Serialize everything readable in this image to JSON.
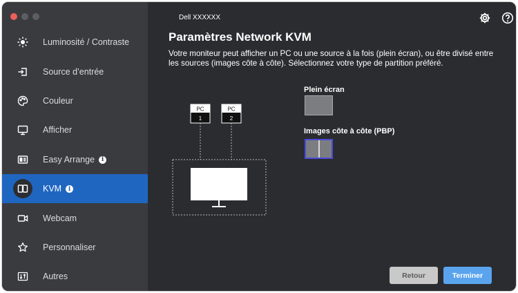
{
  "window": {
    "monitor_name": "Dell XXXXXX"
  },
  "sidebar": {
    "items": [
      {
        "label": "Luminosité / Contraste",
        "icon": "brightness-icon",
        "info": false,
        "active": false
      },
      {
        "label": "Source d’entrée",
        "icon": "input-source-icon",
        "info": false,
        "active": false
      },
      {
        "label": "Couleur",
        "icon": "color-palette-icon",
        "info": false,
        "active": false
      },
      {
        "label": "Afficher",
        "icon": "display-icon",
        "info": false,
        "active": false
      },
      {
        "label": "Easy Arrange",
        "icon": "easy-arrange-icon",
        "info": true,
        "active": false
      },
      {
        "label": "KVM",
        "icon": "kvm-icon",
        "info": true,
        "active": true
      },
      {
        "label": "Webcam",
        "icon": "webcam-icon",
        "info": false,
        "active": false
      },
      {
        "label": "Personnaliser",
        "icon": "star-icon",
        "info": false,
        "active": false
      },
      {
        "label": "Autres",
        "icon": "others-icon",
        "info": false,
        "active": false
      }
    ]
  },
  "main": {
    "title": "Paramètres Network KVM",
    "description": "Votre moniteur peut afficher un PC ou une source à la fois (plein écran), ou être divisé entre les sources (images côte à côte). Sélectionnez votre type de partition préféré.",
    "diagram": {
      "pc1_top": "PC",
      "pc1_num": "1",
      "pc2_top": "PC",
      "pc2_num": "2"
    },
    "options": {
      "fullscreen_label": "Plein écran",
      "pbp_label": "Images côte à côte (PBP)",
      "selected": "pbp"
    },
    "buttons": {
      "back": "Retour",
      "finish": "Terminer"
    }
  },
  "colors": {
    "accent": "#1f66c1",
    "background": "#2b2c30",
    "sidebar": "#3a3b3f",
    "finish_button": "#5aa4ee",
    "selection": "#4a4ad8"
  }
}
